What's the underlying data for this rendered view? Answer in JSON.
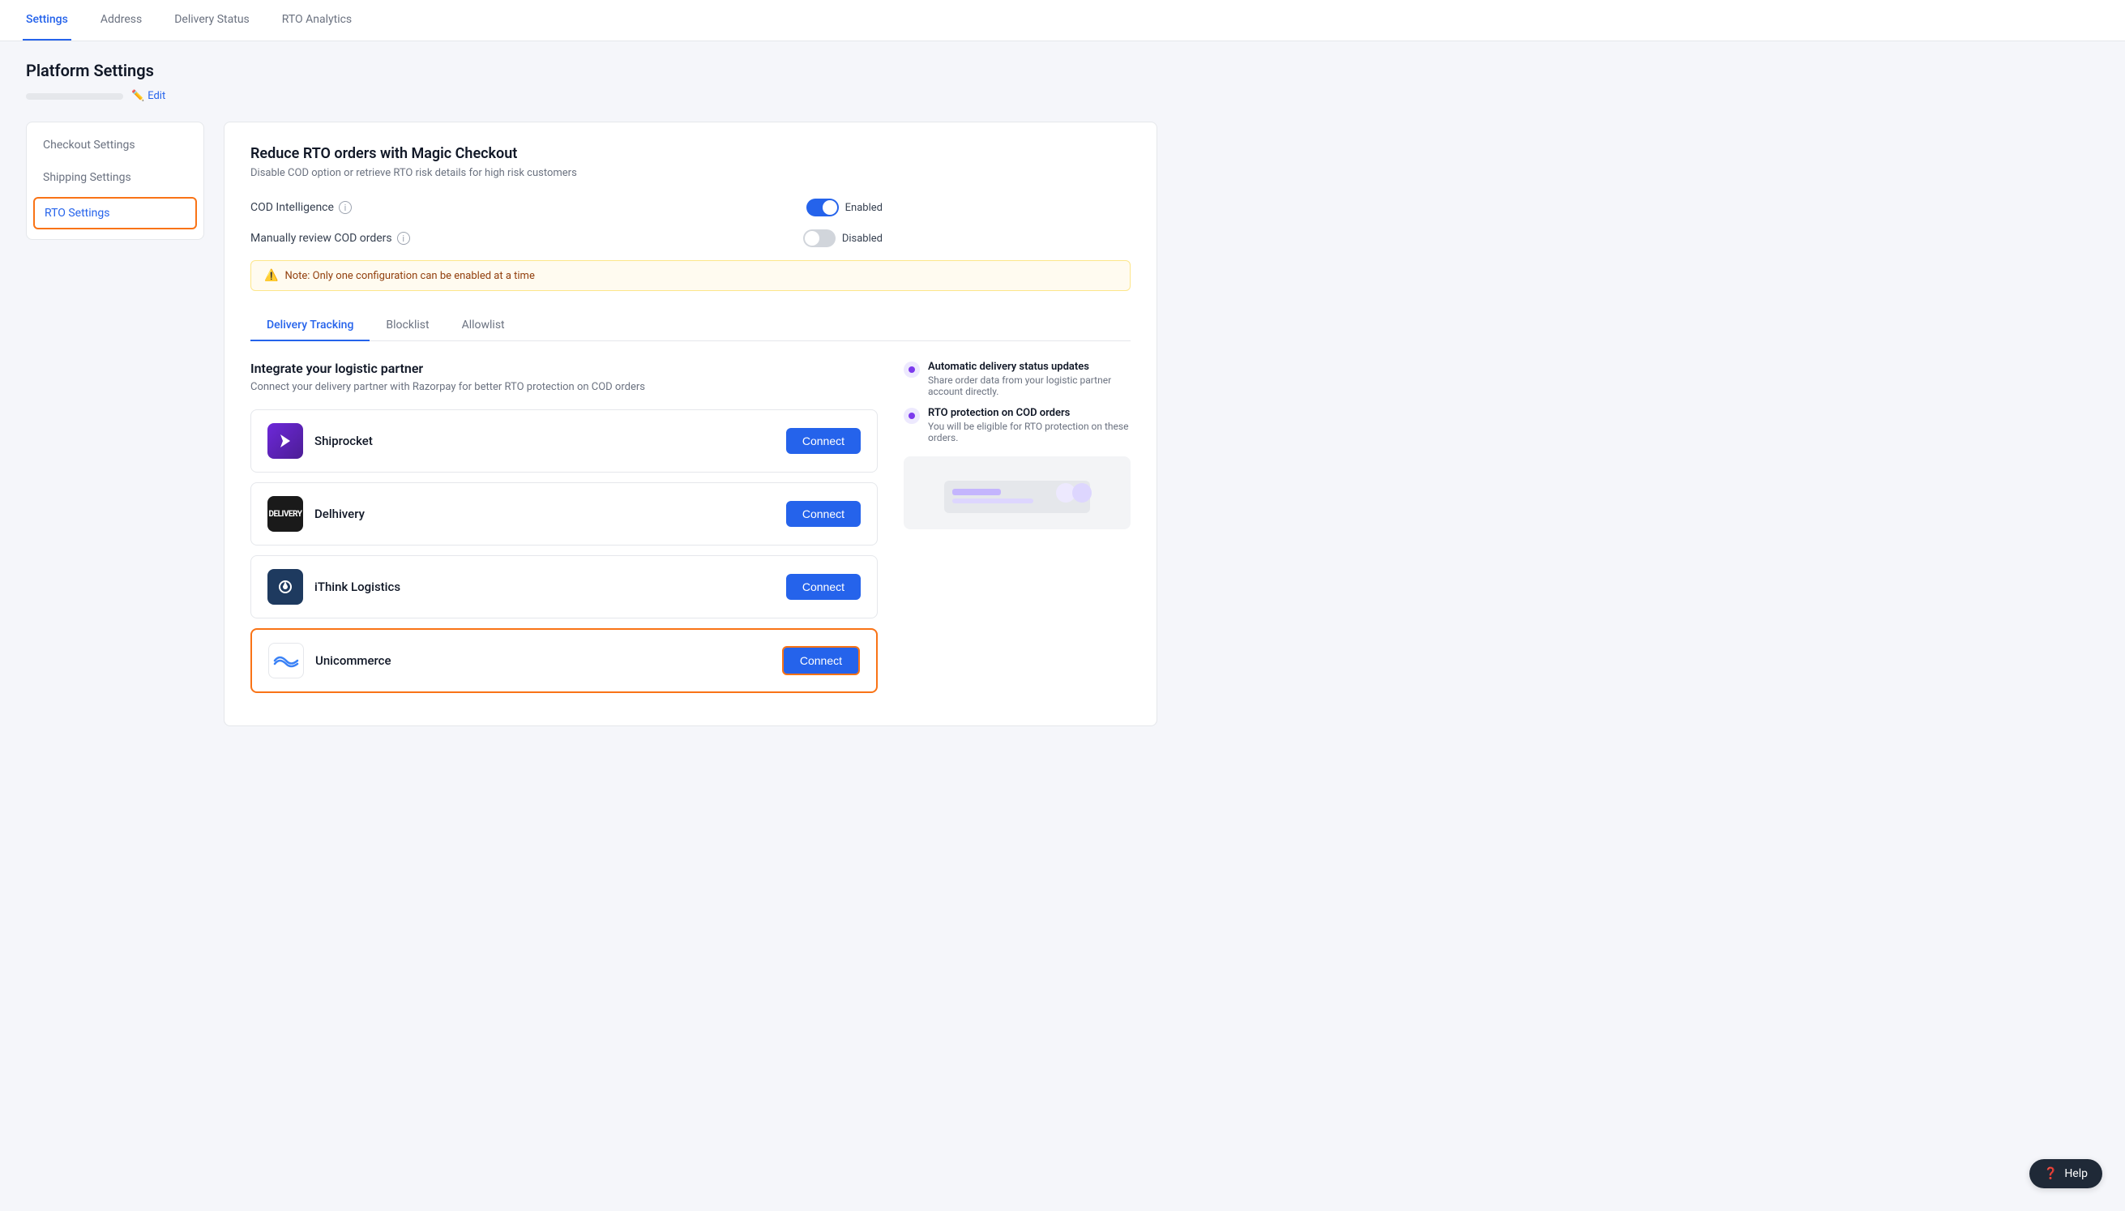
{
  "nav": {
    "tabs": [
      {
        "label": "Settings",
        "active": true
      },
      {
        "label": "Address",
        "active": false
      },
      {
        "label": "Delivery Status",
        "active": false
      },
      {
        "label": "RTO Analytics",
        "active": false
      }
    ]
  },
  "platform": {
    "title": "Platform Settings",
    "edit_label": "Edit"
  },
  "sidebar": {
    "items": [
      {
        "label": "Checkout Settings",
        "active": false,
        "id": "checkout-settings"
      },
      {
        "label": "Shipping Settings",
        "active": false,
        "id": "shipping-settings"
      },
      {
        "label": "RTO Settings",
        "active": true,
        "id": "rto-settings"
      }
    ]
  },
  "rto_section": {
    "title": "Reduce RTO orders with Magic Checkout",
    "subtitle": "Disable COD option or retrieve RTO risk details for high risk customers",
    "cod_intelligence_label": "COD Intelligence",
    "manually_review_label": "Manually review COD orders",
    "cod_toggle_state": "on",
    "cod_toggle_label": "Enabled",
    "manual_toggle_state": "off",
    "manual_toggle_label": "Disabled",
    "note_text": "Note: Only one configuration can be enabled at a time"
  },
  "inner_tabs": [
    {
      "label": "Delivery Tracking",
      "active": true
    },
    {
      "label": "Blocklist",
      "active": false
    },
    {
      "label": "Allowlist",
      "active": false
    }
  ],
  "integrate": {
    "title": "Integrate your logistic partner",
    "subtitle": "Connect your delivery partner with Razorpay for better RTO protection on COD orders",
    "partners": [
      {
        "name": "Shiprocket",
        "logo_type": "shiprocket",
        "connect_label": "Connect",
        "highlighted": false
      },
      {
        "name": "Delhivery",
        "logo_type": "delhivery",
        "connect_label": "Connect",
        "highlighted": false
      },
      {
        "name": "iThink Logistics",
        "logo_type": "ithink",
        "connect_label": "Connect",
        "highlighted": false
      },
      {
        "name": "Unicommerce",
        "logo_type": "unicommerce",
        "connect_label": "Connect",
        "highlighted": true
      }
    ]
  },
  "info_panel": {
    "bullets": [
      {
        "title": "Automatic delivery status updates",
        "subtitle": "Share order data from your logistic partner account directly."
      },
      {
        "title": "RTO protection on COD orders",
        "subtitle": "You will be eligible for RTO protection on these orders."
      }
    ]
  },
  "help": {
    "label": "Help"
  }
}
